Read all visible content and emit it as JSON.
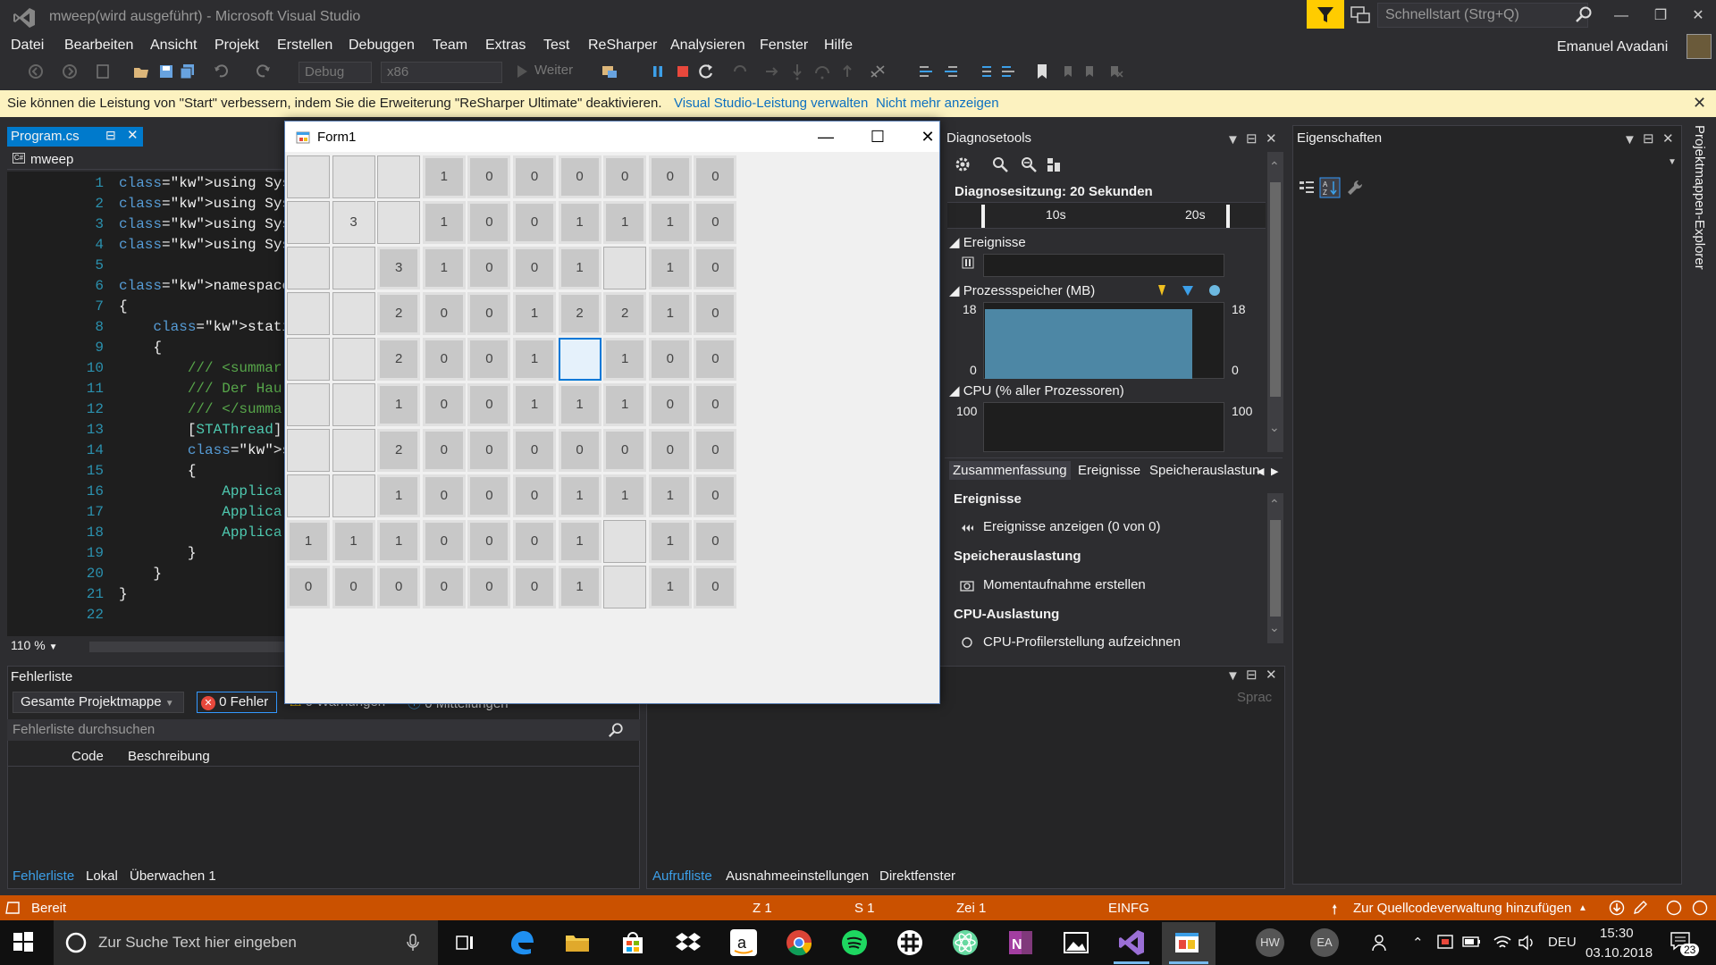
{
  "window": {
    "title": "mweep(wird ausgeführt) - Microsoft Visual Studio",
    "quicklaunch_placeholder": "Schnellstart (Strg+Q)",
    "user": "Emanuel Avadani"
  },
  "menu": [
    "Datei",
    "Bearbeiten",
    "Ansicht",
    "Projekt",
    "Erstellen",
    "Debuggen",
    "Team",
    "Extras",
    "Test",
    "ReSharper",
    "Analysieren",
    "Fenster",
    "Hilfe"
  ],
  "toolbar": {
    "config": "Debug",
    "platform": "x86",
    "continue_label": "Weiter"
  },
  "infobar": {
    "text": "Sie können die Leistung von \"Start\" verbessern, indem Sie die Erweiterung \"ReSharper Ultimate\" deaktivieren.",
    "link1": "Visual Studio-Leistung verwalten",
    "link2": "Nicht mehr anzeigen"
  },
  "editor": {
    "tab": "Program.cs",
    "nav": "mweep",
    "zoom": "110 %",
    "lines": [
      {
        "n": "1",
        "code": "using System;"
      },
      {
        "n": "2",
        "code": "using System.Collec"
      },
      {
        "n": "3",
        "code": "using System.Linq;"
      },
      {
        "n": "4",
        "code": "using System.Window"
      },
      {
        "n": "5",
        "code": ""
      },
      {
        "n": "6",
        "code": "namespace mweep"
      },
      {
        "n": "7",
        "code": "{"
      },
      {
        "n": "8",
        "code": "    static class Pr"
      },
      {
        "n": "9",
        "code": "    {"
      },
      {
        "n": "10",
        "code": "        /// <summar"
      },
      {
        "n": "11",
        "code": "        /// Der Hau"
      },
      {
        "n": "12",
        "code": "        /// </summa"
      },
      {
        "n": "13",
        "code": "        [STAThread]"
      },
      {
        "n": "14",
        "code": "        static void"
      },
      {
        "n": "15",
        "code": "        {"
      },
      {
        "n": "16",
        "code": "            Applica"
      },
      {
        "n": "17",
        "code": "            Applica"
      },
      {
        "n": "18",
        "code": "            Applica"
      },
      {
        "n": "19",
        "code": "        }"
      },
      {
        "n": "20",
        "code": "    }"
      },
      {
        "n": "21",
        "code": "}"
      },
      {
        "n": "22",
        "code": ""
      }
    ]
  },
  "form1": {
    "title": "Form1",
    "grid": [
      [
        "",
        "",
        "",
        "1",
        "0",
        "0",
        "0",
        "0",
        "0",
        "0"
      ],
      [
        "",
        "3",
        "",
        "1",
        "0",
        "0",
        "1",
        "1",
        "1",
        "0"
      ],
      [
        "",
        "",
        "3",
        "1",
        "0",
        "0",
        "1",
        "",
        "1",
        "0"
      ],
      [
        "",
        "",
        "2",
        "0",
        "0",
        "1",
        "2",
        "2",
        "1",
        "0"
      ],
      [
        "",
        "",
        "2",
        "0",
        "0",
        "1",
        "",
        "1",
        "0",
        "0"
      ],
      [
        "",
        "",
        "1",
        "0",
        "0",
        "1",
        "1",
        "1",
        "0",
        "0"
      ],
      [
        "",
        "",
        "2",
        "0",
        "0",
        "0",
        "0",
        "0",
        "0",
        "0"
      ],
      [
        "",
        "",
        "1",
        "0",
        "0",
        "0",
        "1",
        "1",
        "1",
        "0"
      ],
      [
        "1",
        "1",
        "1",
        "0",
        "0",
        "0",
        "1",
        "",
        "1",
        "0"
      ],
      [
        "0",
        "0",
        "0",
        "0",
        "0",
        "0",
        "1",
        "",
        "1",
        "0"
      ]
    ],
    "open": [
      [
        0,
        0,
        0,
        1,
        1,
        1,
        1,
        1,
        1,
        1
      ],
      [
        0,
        2,
        0,
        1,
        1,
        1,
        1,
        1,
        1,
        1
      ],
      [
        0,
        0,
        1,
        1,
        1,
        1,
        1,
        0,
        1,
        1
      ],
      [
        0,
        0,
        1,
        1,
        1,
        1,
        1,
        1,
        1,
        1
      ],
      [
        0,
        0,
        1,
        1,
        1,
        1,
        3,
        1,
        1,
        1
      ],
      [
        0,
        0,
        1,
        1,
        1,
        1,
        1,
        1,
        1,
        1
      ],
      [
        0,
        0,
        1,
        1,
        1,
        1,
        1,
        1,
        1,
        1
      ],
      [
        0,
        0,
        1,
        1,
        1,
        1,
        1,
        1,
        1,
        1
      ],
      [
        1,
        1,
        1,
        1,
        1,
        1,
        1,
        0,
        1,
        1
      ],
      [
        1,
        1,
        1,
        1,
        1,
        1,
        1,
        0,
        1,
        1
      ]
    ]
  },
  "diagnose": {
    "title": "Diagnosetools",
    "session": "Diagnosesitzung: 20 Sekunden",
    "tick1": "10s",
    "tick2": "20s",
    "events": "Ereignisse",
    "memory": "Prozessspeicher (MB)",
    "mem_max": "18",
    "mem_min": "0",
    "memory_fraction": 0.95,
    "cpu": "CPU (% aller Prozessoren)",
    "cpu_max": "100",
    "tabs": [
      "Zusammenfassung",
      "Ereignisse",
      "Speicherauslastun"
    ],
    "sec_events": "Ereignisse",
    "act_events": "Ereignisse anzeigen (0 von 0)",
    "sec_memory": "Speicherauslastung",
    "act_memory": "Momentaufnahme erstellen",
    "sec_cpu": "CPU-Auslastung",
    "act_cpu": "CPU-Profilerstellung aufzeichnen"
  },
  "properties": {
    "title": "Eigenschaften",
    "side_tab": "Projektmappen-Explorer"
  },
  "errorlist": {
    "title": "Fehlerliste",
    "scope": "Gesamte Projektmappe",
    "errors": "0 Fehler",
    "warnings": "0 Warnungen",
    "messages": "0 Mitteilungen",
    "search": "Fehlerliste durchsuchen",
    "col_code": "Code",
    "col_desc": "Beschreibung",
    "tabs": [
      "Fehlerliste",
      "Lokal",
      "Überwachen 1"
    ]
  },
  "callstack": {
    "col_lang": "Sprac",
    "tabs": [
      "Aufrufliste",
      "Ausnahmeeinstellungen",
      "Direktfenster"
    ]
  },
  "status": {
    "state": "Bereit",
    "z": "Z 1",
    "s": "S 1",
    "zei": "Zei 1",
    "mode": "EINFG",
    "scm": "Zur Quellcodeverwaltung hinzufügen"
  },
  "taskbar": {
    "search": "Zur Suche Text hier eingeben",
    "lang": "DEU",
    "time": "15:30",
    "date": "03.10.2018",
    "notif": "23",
    "hw": "HW",
    "ea": "EA"
  },
  "colors": {
    "accent": "#007acc",
    "statusbar": "#ca5100",
    "infobar": "#fcf2c0",
    "memory_fill": "#4d87a5"
  }
}
